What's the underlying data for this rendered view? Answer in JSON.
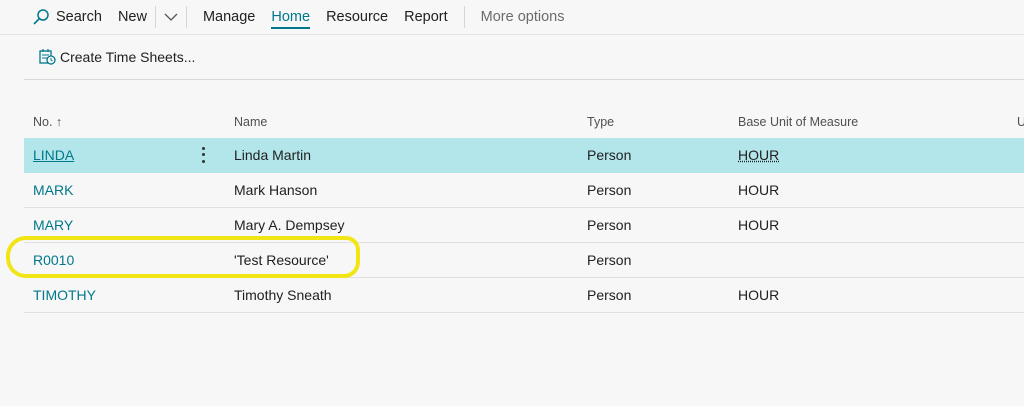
{
  "toolbar": {
    "search_label": "Search",
    "new_label": "New",
    "manage_label": "Manage",
    "home_label": "Home",
    "resource_label": "Resource",
    "report_label": "Report",
    "more_label": "More options"
  },
  "actions": {
    "create_time_sheets": "Create Time Sheets..."
  },
  "columns": {
    "no": "No. ↑",
    "name": "Name",
    "type": "Type",
    "base_unit": "Base Unit of Measure",
    "unit_cut": "U"
  },
  "rows": [
    {
      "no": "LINDA",
      "name": "Linda Martin",
      "type": "Person",
      "base_unit": "HOUR"
    },
    {
      "no": "MARK",
      "name": "Mark Hanson",
      "type": "Person",
      "base_unit": "HOUR"
    },
    {
      "no": "MARY",
      "name": "Mary A. Dempsey",
      "type": "Person",
      "base_unit": "HOUR"
    },
    {
      "no": "R0010",
      "name": "'Test Resource'",
      "type": "Person",
      "base_unit": ""
    },
    {
      "no": "TIMOTHY",
      "name": "Timothy Sneath",
      "type": "Person",
      "base_unit": "HOUR"
    }
  ],
  "colors": {
    "accent": "#00788c",
    "selected_row": "#b2e6ea",
    "highlight": "#f2e516"
  }
}
